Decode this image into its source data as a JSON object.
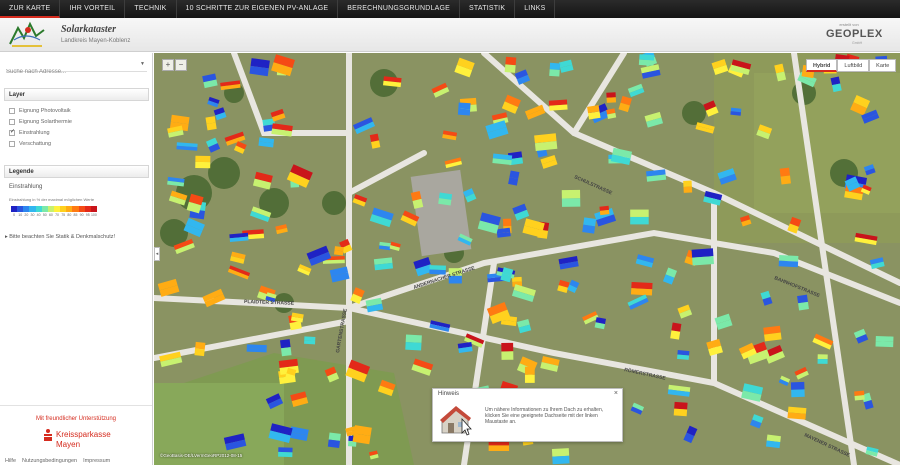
{
  "nav": {
    "items": [
      "ZUR KARTE",
      "IHR VORTEIL",
      "TECHNIK",
      "10 SCHRITTE ZUR EIGENEN PV-ANLAGE",
      "BERECHNUNGSGRUNDLAGE",
      "STATISTIK",
      "LINKS"
    ],
    "active_index": 0
  },
  "header": {
    "title": "Solarkataster",
    "subtitle": "Landkreis Mayen-Koblenz",
    "partner": {
      "small": "erstellt von",
      "brand": "GEOPLEX",
      "sub": "GmbH"
    }
  },
  "sidebar": {
    "search_placeholder": "Suche nach Adresse...",
    "layer_title": "Layer",
    "layers": [
      {
        "label": "Eignung Photovoltaik",
        "checked": false
      },
      {
        "label": "Eignung Solarthermie",
        "checked": false
      },
      {
        "label": "Einstrahlung",
        "checked": true
      },
      {
        "label": "Verschattung",
        "checked": false
      }
    ],
    "legend_title": "Legende",
    "legend_heading": "Einstrahlung",
    "legend_note": "Einstrahlung in % der maximal möglichen Werte",
    "legend_ticks": [
      "0",
      "10",
      "20",
      "30",
      "40",
      "50",
      "60",
      "70",
      "75",
      "80",
      "85",
      "90",
      "95",
      "100"
    ],
    "legend_colors": [
      "#1f22c4",
      "#2a55e0",
      "#2d86ef",
      "#32b7ef",
      "#3fd9d4",
      "#7be9a9",
      "#c7f170",
      "#fff13c",
      "#ffd11e",
      "#ffac14",
      "#ff7a12",
      "#f54a15",
      "#e32919",
      "#c9141b"
    ],
    "hint": "Bitte beachten Sie Statik & Denkmalschutz!",
    "sponsor_text": "Mit freundlicher Unterstützung",
    "sponsor_name_1": "Kreissparkasse",
    "sponsor_name_2": "Mayen",
    "footer": [
      "Hilfe",
      "Nutzungsbedingungen",
      "Impressum"
    ]
  },
  "map": {
    "zoom_in": "+",
    "zoom_out": "−",
    "collapse": "◂",
    "map_types": [
      "Hybrid",
      "Luftbild",
      "Karte"
    ],
    "active_map_type": "Hybrid",
    "copyright": "©GeoBasis-DE/LVermGeoRP2012-08-15",
    "street_labels": [
      "PLAIDTER STRASSE",
      "ANDERNACHER STRASSE",
      "SCHULSTRASSE",
      "BAHNHOFSTRASSE",
      "RÖMERSTRASSE",
      "MAYENER STRASSE",
      "GARTENSTRASSE"
    ]
  },
  "popup": {
    "title": "Hinweis",
    "close": "×",
    "text": "Um nähere Informationen zu Ihrem Dach zu erhalten, klicken Sie eine geeignete Dachseite mit der linken Maustaste an."
  }
}
